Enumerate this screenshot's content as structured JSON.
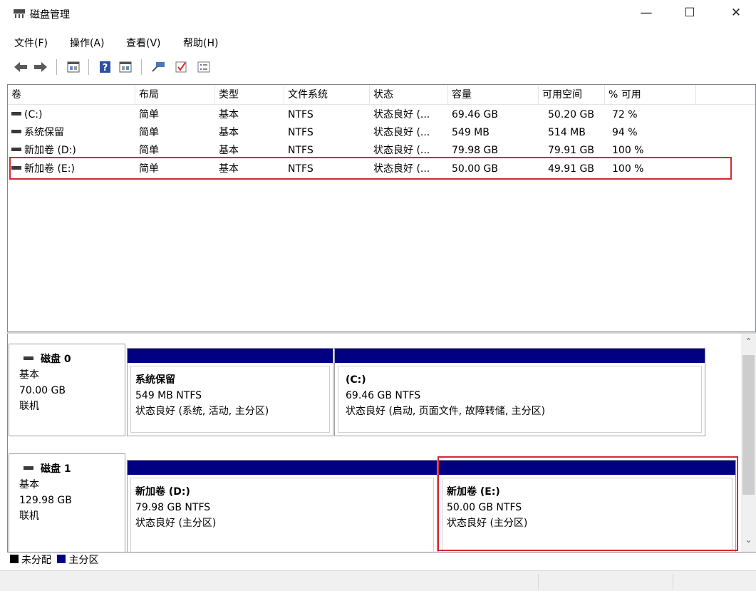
{
  "window": {
    "title": "磁盘管理",
    "min": "—",
    "max": "☐",
    "close": "✕"
  },
  "menu": [
    "文件(F)",
    "操作(A)",
    "查看(V)",
    "帮助(H)"
  ],
  "toolbar": [
    "back-arrow-icon",
    "forward-arrow-icon",
    "properties-icon",
    "help-icon",
    "console-tree-icon",
    "connect-icon",
    "check-icon",
    "list-icon"
  ],
  "columns": [
    "卷",
    "布局",
    "类型",
    "文件系统",
    "状态",
    "容量",
    "可用空间",
    "% 可用"
  ],
  "volumes": [
    [
      "(C:)",
      "简单",
      "基本",
      "NTFS",
      "状态良好 (...",
      "69.46 GB",
      "50.20 GB",
      "72 %"
    ],
    [
      "系统保留",
      "简单",
      "基本",
      "NTFS",
      "状态良好 (...",
      "549 MB",
      "514 MB",
      "94 %"
    ],
    [
      "新加卷 (D:)",
      "简单",
      "基本",
      "NTFS",
      "状态良好 (...",
      "79.98 GB",
      "79.91 GB",
      "100 %"
    ],
    [
      "新加卷 (E:)",
      "简单",
      "基本",
      "NTFS",
      "状态良好 (...",
      "50.00 GB",
      "49.91 GB",
      "100 %"
    ]
  ],
  "disks": [
    {
      "name": "磁盘 0",
      "type": "基本",
      "size": "70.00 GB",
      "status": "联机",
      "partitions": [
        {
          "name": "系统保留",
          "fs": "549 MB NTFS",
          "status": "状态良好 (系统, 活动, 主分区)"
        },
        {
          "name": "(C:)",
          "fs": "69.46 GB NTFS",
          "status": "状态良好 (启动, 页面文件, 故障转储, 主分区)"
        }
      ]
    },
    {
      "name": "磁盘 1",
      "type": "基本",
      "size": "129.98 GB",
      "status": "联机",
      "partitions": [
        {
          "name": "新加卷 (D:)",
          "fs": "79.98 GB NTFS",
          "status": "状态良好 (主分区)"
        },
        {
          "name": "新加卷 (E:)",
          "fs": "50.00 GB NTFS",
          "status": "状态良好 (主分区)"
        }
      ]
    }
  ],
  "legend": [
    {
      "label": "未分配",
      "color": "#000000"
    },
    {
      "label": "主分区",
      "color": "#000080"
    }
  ],
  "colors": {
    "partition_bar": "#000080",
    "highlight": "#d6282f"
  }
}
